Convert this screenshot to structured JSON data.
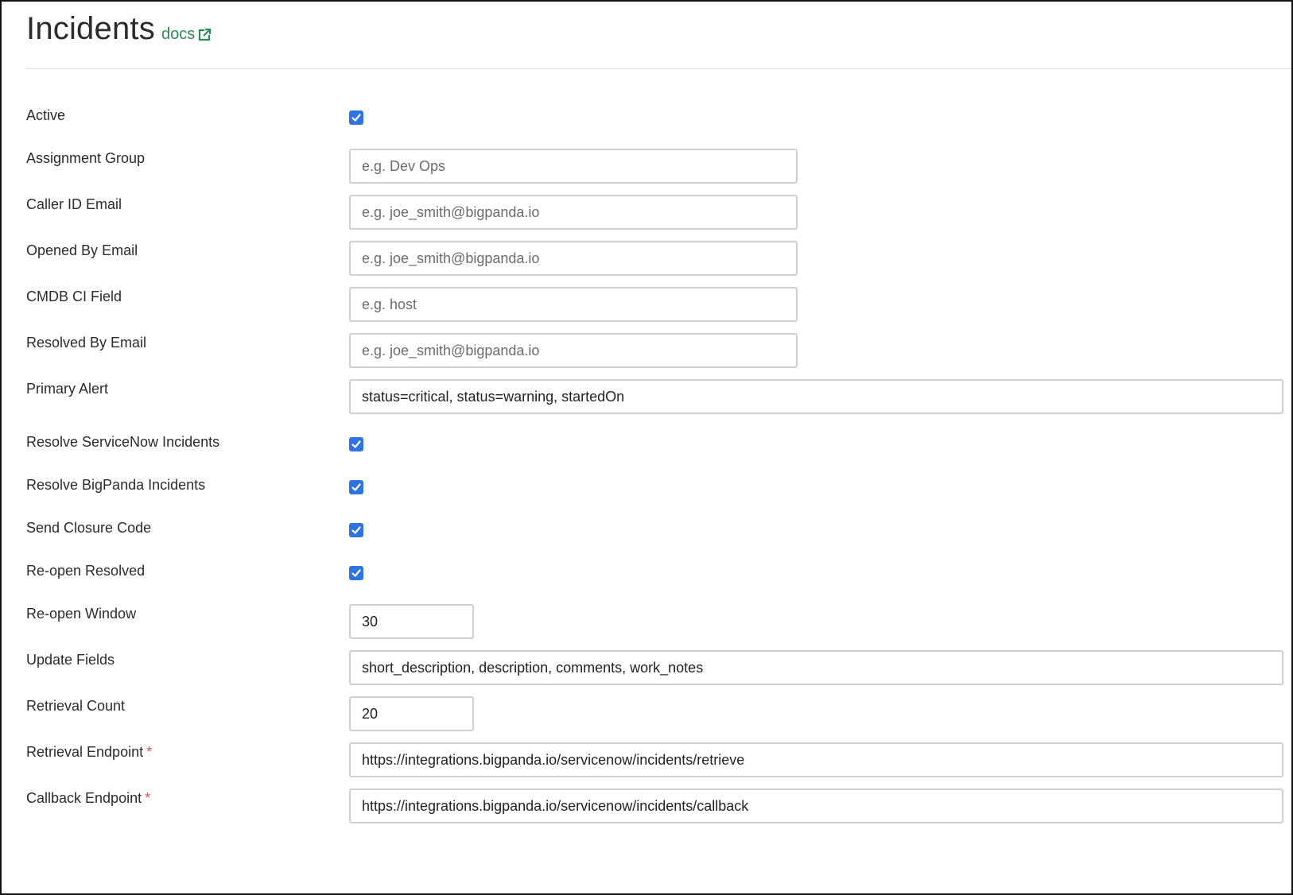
{
  "header": {
    "title": "Incidents",
    "docs_label": "docs"
  },
  "form": {
    "active": {
      "label": "Active",
      "checked": true
    },
    "assignment_group": {
      "label": "Assignment Group",
      "placeholder": "e.g. Dev Ops",
      "value": ""
    },
    "caller_id_email": {
      "label": "Caller ID Email",
      "placeholder": "e.g. joe_smith@bigpanda.io",
      "value": ""
    },
    "opened_by_email": {
      "label": "Opened By Email",
      "placeholder": "e.g. joe_smith@bigpanda.io",
      "value": ""
    },
    "cmdb_ci_field": {
      "label": "CMDB CI Field",
      "placeholder": "e.g. host",
      "value": ""
    },
    "resolved_by_email": {
      "label": "Resolved By Email",
      "placeholder": "e.g. joe_smith@bigpanda.io",
      "value": ""
    },
    "primary_alert": {
      "label": "Primary Alert",
      "value": "status=critical, status=warning, startedOn"
    },
    "resolve_servicenow_incidents": {
      "label": "Resolve ServiceNow Incidents",
      "checked": true
    },
    "resolve_bigpanda_incidents": {
      "label": "Resolve BigPanda Incidents",
      "checked": true
    },
    "send_closure_code": {
      "label": "Send Closure Code",
      "checked": true
    },
    "reopen_resolved": {
      "label": "Re-open Resolved",
      "checked": true
    },
    "reopen_window": {
      "label": "Re-open Window",
      "value": "30"
    },
    "update_fields": {
      "label": "Update Fields",
      "value": "short_description, description, comments, work_notes"
    },
    "retrieval_count": {
      "label": "Retrieval Count",
      "value": "20"
    },
    "retrieval_endpoint": {
      "label": "Retrieval Endpoint",
      "required_mark": "*",
      "value": "https://integrations.bigpanda.io/servicenow/incidents/retrieve"
    },
    "callback_endpoint": {
      "label": "Callback Endpoint",
      "required_mark": "*",
      "value": "https://integrations.bigpanda.io/servicenow/incidents/callback"
    }
  },
  "colors": {
    "accent_checkbox": "#2f73e0",
    "docs_link": "#2e8b57",
    "required_marker": "#d9534f"
  },
  "icons": {
    "docs": "external-link-icon",
    "checkbox": "check-icon"
  }
}
